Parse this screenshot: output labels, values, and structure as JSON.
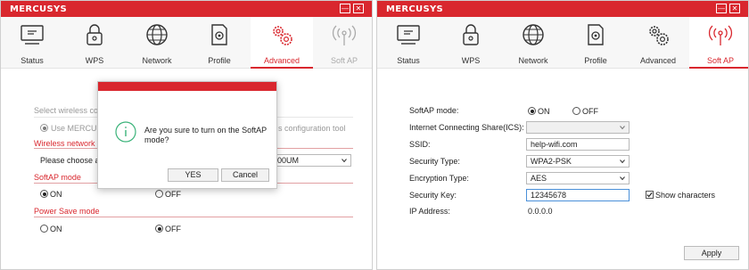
{
  "left": {
    "logo": "MERCUSYS",
    "tabs": [
      {
        "label": "Status"
      },
      {
        "label": "WPS"
      },
      {
        "label": "Network"
      },
      {
        "label": "Profile"
      },
      {
        "label": "Advanced"
      },
      {
        "label": "Soft AP"
      }
    ],
    "active_tab": "Advanced",
    "select_wireless_label": "Select wireless con",
    "use_option_label": "Use MERCUSYS",
    "config_tool_text": "s configuration tool",
    "wireless_adapter_section": "Wireless network a",
    "please_choose_label": "Please choose a",
    "adapter_value": "300UM",
    "softap_section": "SoftAP mode",
    "softap_on_label": "ON",
    "softap_off_label": "OFF",
    "softap_value": "ON",
    "power_save_section": "Power Save mode",
    "power_on_label": "ON",
    "power_off_label": "OFF",
    "power_save_value": "OFF",
    "dialog": {
      "message": "Are you sure to turn on the SoftAP mode?",
      "yes_label": "YES",
      "cancel_label": "Cancel"
    }
  },
  "right": {
    "logo": "MERCUSYS",
    "tabs": [
      {
        "label": "Status"
      },
      {
        "label": "WPS"
      },
      {
        "label": "Network"
      },
      {
        "label": "Profile"
      },
      {
        "label": "Advanced"
      },
      {
        "label": "Soft AP"
      }
    ],
    "active_tab": "Soft AP",
    "softap_mode_label": "SoftAP mode:",
    "on_label": "ON",
    "off_label": "OFF",
    "softap_mode_value": "ON",
    "ics_label": "Internet Connecting Share(ICS):",
    "ics_value": "",
    "ssid_label": "SSID:",
    "ssid_value": "help-wifi.com",
    "security_type_label": "Security Type:",
    "security_type_value": "WPA2-PSK",
    "encryption_type_label": "Encryption Type:",
    "encryption_type_value": "AES",
    "security_key_label": "Security Key:",
    "security_key_value": "12345678",
    "show_characters_label": "Show characters",
    "show_characters_checked": true,
    "ip_address_label": "IP Address:",
    "ip_address_value": "0.0.0.0",
    "apply_label": "Apply"
  },
  "colors": {
    "brand_red": "#d9272e",
    "dialog_icon_green": "#3bb37a"
  },
  "icons": [
    "monitor-icon",
    "lock-icon",
    "globe-icon",
    "document-gear-icon",
    "gears-icon",
    "antenna-icon",
    "info-circle-icon",
    "chevron-down-icon",
    "minimize-icon",
    "close-icon"
  ]
}
